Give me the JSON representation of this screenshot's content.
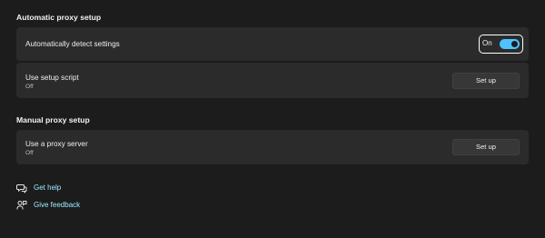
{
  "sections": {
    "automatic": {
      "title": "Automatic proxy setup",
      "detect": {
        "label": "Automatically detect settings",
        "toggle_state": "On",
        "toggle_on": true,
        "accent": "#4cc2ff"
      },
      "script": {
        "label": "Use setup script",
        "status": "Off",
        "button": "Set up"
      }
    },
    "manual": {
      "title": "Manual proxy setup",
      "proxy": {
        "label": "Use a proxy server",
        "status": "Off",
        "button": "Set up"
      }
    }
  },
  "links": {
    "help": {
      "label": "Get help",
      "icon": "help-chat-icon"
    },
    "feedback": {
      "label": "Give feedback",
      "icon": "feedback-person-icon"
    }
  }
}
